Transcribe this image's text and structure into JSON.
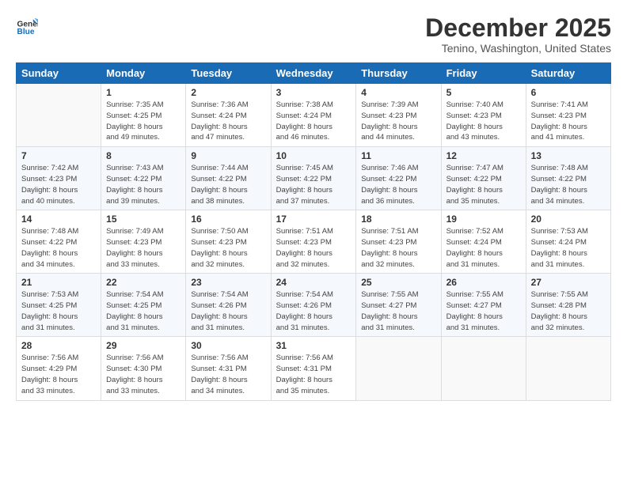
{
  "logo": {
    "line1": "General",
    "line2": "Blue"
  },
  "title": "December 2025",
  "location": "Tenino, Washington, United States",
  "weekdays": [
    "Sunday",
    "Monday",
    "Tuesday",
    "Wednesday",
    "Thursday",
    "Friday",
    "Saturday"
  ],
  "weeks": [
    [
      {
        "day": "",
        "info": ""
      },
      {
        "day": "1",
        "info": "Sunrise: 7:35 AM\nSunset: 4:25 PM\nDaylight: 8 hours\nand 49 minutes."
      },
      {
        "day": "2",
        "info": "Sunrise: 7:36 AM\nSunset: 4:24 PM\nDaylight: 8 hours\nand 47 minutes."
      },
      {
        "day": "3",
        "info": "Sunrise: 7:38 AM\nSunset: 4:24 PM\nDaylight: 8 hours\nand 46 minutes."
      },
      {
        "day": "4",
        "info": "Sunrise: 7:39 AM\nSunset: 4:23 PM\nDaylight: 8 hours\nand 44 minutes."
      },
      {
        "day": "5",
        "info": "Sunrise: 7:40 AM\nSunset: 4:23 PM\nDaylight: 8 hours\nand 43 minutes."
      },
      {
        "day": "6",
        "info": "Sunrise: 7:41 AM\nSunset: 4:23 PM\nDaylight: 8 hours\nand 41 minutes."
      }
    ],
    [
      {
        "day": "7",
        "info": "Sunrise: 7:42 AM\nSunset: 4:23 PM\nDaylight: 8 hours\nand 40 minutes."
      },
      {
        "day": "8",
        "info": "Sunrise: 7:43 AM\nSunset: 4:22 PM\nDaylight: 8 hours\nand 39 minutes."
      },
      {
        "day": "9",
        "info": "Sunrise: 7:44 AM\nSunset: 4:22 PM\nDaylight: 8 hours\nand 38 minutes."
      },
      {
        "day": "10",
        "info": "Sunrise: 7:45 AM\nSunset: 4:22 PM\nDaylight: 8 hours\nand 37 minutes."
      },
      {
        "day": "11",
        "info": "Sunrise: 7:46 AM\nSunset: 4:22 PM\nDaylight: 8 hours\nand 36 minutes."
      },
      {
        "day": "12",
        "info": "Sunrise: 7:47 AM\nSunset: 4:22 PM\nDaylight: 8 hours\nand 35 minutes."
      },
      {
        "day": "13",
        "info": "Sunrise: 7:48 AM\nSunset: 4:22 PM\nDaylight: 8 hours\nand 34 minutes."
      }
    ],
    [
      {
        "day": "14",
        "info": "Sunrise: 7:48 AM\nSunset: 4:22 PM\nDaylight: 8 hours\nand 34 minutes."
      },
      {
        "day": "15",
        "info": "Sunrise: 7:49 AM\nSunset: 4:23 PM\nDaylight: 8 hours\nand 33 minutes."
      },
      {
        "day": "16",
        "info": "Sunrise: 7:50 AM\nSunset: 4:23 PM\nDaylight: 8 hours\nand 32 minutes."
      },
      {
        "day": "17",
        "info": "Sunrise: 7:51 AM\nSunset: 4:23 PM\nDaylight: 8 hours\nand 32 minutes."
      },
      {
        "day": "18",
        "info": "Sunrise: 7:51 AM\nSunset: 4:23 PM\nDaylight: 8 hours\nand 32 minutes."
      },
      {
        "day": "19",
        "info": "Sunrise: 7:52 AM\nSunset: 4:24 PM\nDaylight: 8 hours\nand 31 minutes."
      },
      {
        "day": "20",
        "info": "Sunrise: 7:53 AM\nSunset: 4:24 PM\nDaylight: 8 hours\nand 31 minutes."
      }
    ],
    [
      {
        "day": "21",
        "info": "Sunrise: 7:53 AM\nSunset: 4:25 PM\nDaylight: 8 hours\nand 31 minutes."
      },
      {
        "day": "22",
        "info": "Sunrise: 7:54 AM\nSunset: 4:25 PM\nDaylight: 8 hours\nand 31 minutes."
      },
      {
        "day": "23",
        "info": "Sunrise: 7:54 AM\nSunset: 4:26 PM\nDaylight: 8 hours\nand 31 minutes."
      },
      {
        "day": "24",
        "info": "Sunrise: 7:54 AM\nSunset: 4:26 PM\nDaylight: 8 hours\nand 31 minutes."
      },
      {
        "day": "25",
        "info": "Sunrise: 7:55 AM\nSunset: 4:27 PM\nDaylight: 8 hours\nand 31 minutes."
      },
      {
        "day": "26",
        "info": "Sunrise: 7:55 AM\nSunset: 4:27 PM\nDaylight: 8 hours\nand 31 minutes."
      },
      {
        "day": "27",
        "info": "Sunrise: 7:55 AM\nSunset: 4:28 PM\nDaylight: 8 hours\nand 32 minutes."
      }
    ],
    [
      {
        "day": "28",
        "info": "Sunrise: 7:56 AM\nSunset: 4:29 PM\nDaylight: 8 hours\nand 33 minutes."
      },
      {
        "day": "29",
        "info": "Sunrise: 7:56 AM\nSunset: 4:30 PM\nDaylight: 8 hours\nand 33 minutes."
      },
      {
        "day": "30",
        "info": "Sunrise: 7:56 AM\nSunset: 4:31 PM\nDaylight: 8 hours\nand 34 minutes."
      },
      {
        "day": "31",
        "info": "Sunrise: 7:56 AM\nSunset: 4:31 PM\nDaylight: 8 hours\nand 35 minutes."
      },
      {
        "day": "",
        "info": ""
      },
      {
        "day": "",
        "info": ""
      },
      {
        "day": "",
        "info": ""
      }
    ]
  ]
}
